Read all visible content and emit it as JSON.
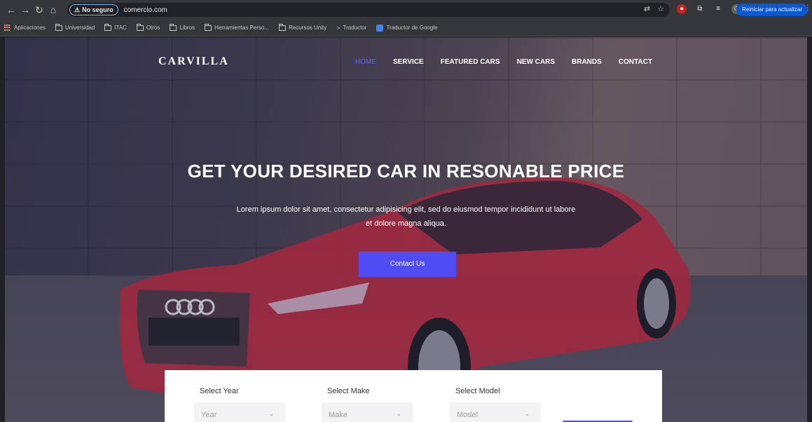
{
  "browser": {
    "security_label": "No seguro",
    "url": "comercio.com",
    "update_button": "Reiniciar para actualizar",
    "bookmarks": [
      {
        "label": "Aplicaciones",
        "icon": "apps-grid-icon"
      },
      {
        "label": "Universidad",
        "icon": "folder-icon"
      },
      {
        "label": "ITAC",
        "icon": "folder-icon"
      },
      {
        "label": "Otros",
        "icon": "folder-icon"
      },
      {
        "label": "Libros",
        "icon": "folder-icon"
      },
      {
        "label": "Herramientas Perso...",
        "icon": "folder-icon"
      },
      {
        "label": "Recursos Unity",
        "icon": "folder-icon"
      },
      {
        "label": "Traductor",
        "icon": "translate-icon"
      },
      {
        "label": "Traductor de Google",
        "icon": "google-translate-icon"
      }
    ]
  },
  "site": {
    "logo": "CARVILLA",
    "nav": [
      "HOME",
      "SERVICE",
      "FEATURED CARS",
      "NEW CARS",
      "BRANDS",
      "CONTACT"
    ],
    "active_nav": "HOME",
    "hero": {
      "title": "GET YOUR DESIRED CAR IN RESONABLE PRICE",
      "text": "Lorem ipsum dolor sit amet, consectetur adipisicing elit, sed do eiusmod tempor incididunt ut labore et dolore magna aliqua.",
      "button": "Contact Us"
    },
    "search": {
      "year_label": "Select Year",
      "year_value": "Year",
      "make_label": "Select Make",
      "make_value": "Make",
      "model_label": "Select Model",
      "model_value": "Model"
    },
    "colors": {
      "accent": "#4f4cf5",
      "car": "#b8283a"
    }
  }
}
